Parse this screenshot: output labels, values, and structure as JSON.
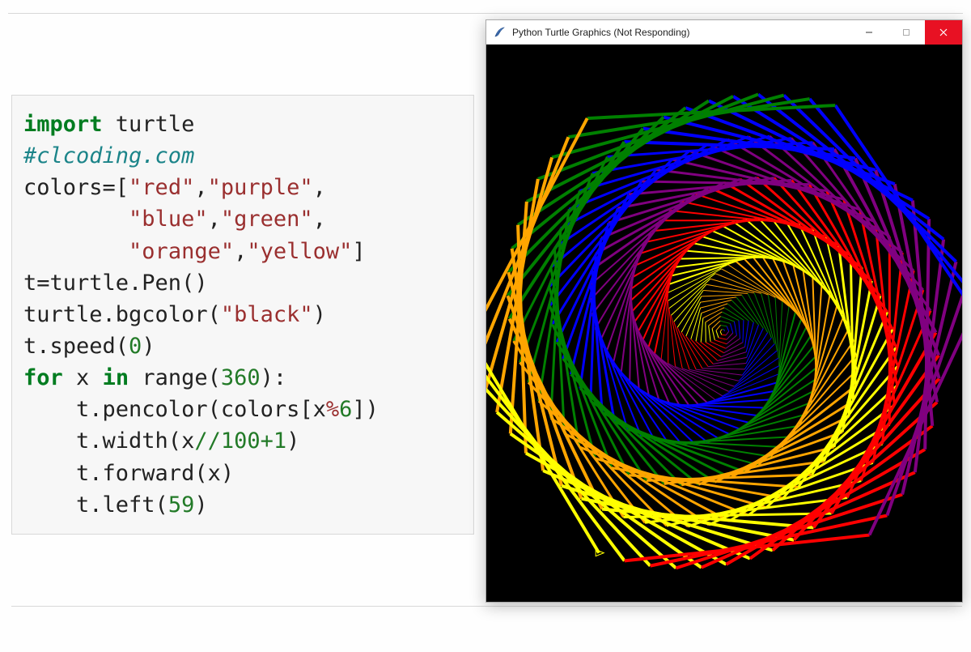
{
  "turtle_window": {
    "title": "Python Turtle Graphics (Not Responding)",
    "icon_name": "feather-icon",
    "minimize_glyph": "─",
    "maximize_glyph": "□",
    "close_glyph": "✕",
    "bgcolor": "#000000"
  },
  "turtle_spiral": {
    "colors": [
      "red",
      "purple",
      "blue",
      "green",
      "orange",
      "yellow"
    ],
    "iterations": 360,
    "turn_angle_deg": 59,
    "pen_width_rule": "x//100 + 1",
    "speed": 0
  },
  "code": {
    "lines": [
      {
        "tokens": [
          {
            "cls": "kw",
            "t": "import"
          },
          {
            "cls": "plain",
            "t": " turtle"
          }
        ]
      },
      {
        "tokens": [
          {
            "cls": "cmt",
            "t": "#clcoding.com"
          }
        ]
      },
      {
        "tokens": [
          {
            "cls": "plain",
            "t": "colors=["
          },
          {
            "cls": "str",
            "t": "\"red\""
          },
          {
            "cls": "plain",
            "t": ","
          },
          {
            "cls": "str",
            "t": "\"purple\""
          },
          {
            "cls": "plain",
            "t": ","
          }
        ]
      },
      {
        "tokens": [
          {
            "cls": "plain",
            "t": "        "
          },
          {
            "cls": "str",
            "t": "\"blue\""
          },
          {
            "cls": "plain",
            "t": ","
          },
          {
            "cls": "str",
            "t": "\"green\""
          },
          {
            "cls": "plain",
            "t": ","
          }
        ]
      },
      {
        "tokens": [
          {
            "cls": "plain",
            "t": "        "
          },
          {
            "cls": "str",
            "t": "\"orange\""
          },
          {
            "cls": "plain",
            "t": ","
          },
          {
            "cls": "str",
            "t": "\"yellow\""
          },
          {
            "cls": "plain",
            "t": "]"
          }
        ]
      },
      {
        "tokens": [
          {
            "cls": "plain",
            "t": "t=turtle.Pen()"
          }
        ]
      },
      {
        "tokens": [
          {
            "cls": "plain",
            "t": "turtle.bgcolor("
          },
          {
            "cls": "str",
            "t": "\"black\""
          },
          {
            "cls": "plain",
            "t": ")"
          }
        ]
      },
      {
        "tokens": [
          {
            "cls": "plain",
            "t": "t.speed("
          },
          {
            "cls": "num",
            "t": "0"
          },
          {
            "cls": "plain",
            "t": ")"
          }
        ]
      },
      {
        "tokens": [
          {
            "cls": "kw",
            "t": "for"
          },
          {
            "cls": "plain",
            "t": " x "
          },
          {
            "cls": "kw",
            "t": "in"
          },
          {
            "cls": "plain",
            "t": " range("
          },
          {
            "cls": "num",
            "t": "360"
          },
          {
            "cls": "plain",
            "t": "):"
          }
        ]
      },
      {
        "tokens": [
          {
            "cls": "plain",
            "t": "    t.pencolor(colors[x"
          },
          {
            "cls": "op",
            "t": "%"
          },
          {
            "cls": "num",
            "t": "6"
          },
          {
            "cls": "plain",
            "t": "])"
          }
        ]
      },
      {
        "tokens": [
          {
            "cls": "plain",
            "t": "    t.width(x"
          },
          {
            "cls": "op2",
            "t": "//"
          },
          {
            "cls": "num",
            "t": "100"
          },
          {
            "cls": "op2",
            "t": "+"
          },
          {
            "cls": "num",
            "t": "1"
          },
          {
            "cls": "plain",
            "t": ")"
          }
        ]
      },
      {
        "tokens": [
          {
            "cls": "plain",
            "t": "    t.forward(x)"
          }
        ]
      },
      {
        "tokens": [
          {
            "cls": "plain",
            "t": "    t.left("
          },
          {
            "cls": "num",
            "t": "59"
          },
          {
            "cls": "plain",
            "t": ")"
          }
        ]
      }
    ]
  }
}
